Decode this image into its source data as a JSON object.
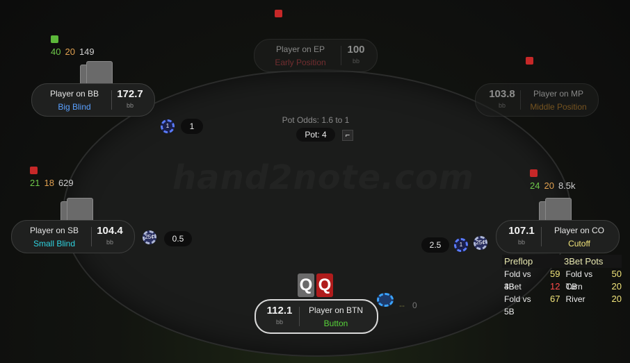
{
  "table": {
    "watermark": "hand2note.com",
    "pot_odds": "Pot Odds: 1.6 to 1",
    "pot": "Pot: 4",
    "pot_icon": "⌐"
  },
  "seats": {
    "ep": {
      "name": "Player on EP",
      "position": "Early Position",
      "stack": "100",
      "unit": "bb"
    },
    "bb": {
      "name": "Player on BB",
      "position": "Big Blind",
      "stack": "172.7",
      "unit": "bb",
      "bet": "1",
      "chip": "1",
      "hud": {
        "a": "40",
        "b": "20",
        "c": "149"
      }
    },
    "mp": {
      "name": "Player on MP",
      "position": "Middle Position",
      "stack": "103.8",
      "unit": "bb"
    },
    "sb": {
      "name": "Player on SB",
      "position": "Small Blind",
      "stack": "104.4",
      "unit": "bb",
      "bet": "0.5",
      "chip": "25¢",
      "hud": {
        "a": "21",
        "b": "18",
        "c": "629"
      }
    },
    "co": {
      "name": "Player on CO",
      "position": "Cutoff",
      "stack": "107.1",
      "unit": "bb",
      "bet": "2.5",
      "chip1": "1",
      "chip2": "25¢",
      "hud": {
        "a": "24",
        "b": "20",
        "c": "8.5k"
      }
    },
    "btn": {
      "name": "Player on BTN",
      "position": "Button",
      "stack": "112.1",
      "unit": "bb",
      "bet": "0",
      "bet_dashes": "--"
    }
  },
  "hero_cards": [
    "Q",
    "Q"
  ],
  "stats_panel": {
    "headers": [
      "Preflop",
      "3Bet Pots"
    ],
    "rows": [
      {
        "l1": "Fold vs 3B",
        "v1": "59",
        "l2": "Fold vs CB",
        "v2": "50"
      },
      {
        "l1": "4Bet",
        "v1": "12",
        "l2": "Turn",
        "v2": "20"
      },
      {
        "l1": "Fold vs 5B",
        "v1": "67",
        "l2": "River",
        "v2": "20"
      }
    ]
  },
  "colors": {
    "small_blind": "#2fd3e0",
    "big_blind": "#5aa0ff",
    "early_position": "#c0444a",
    "middle_position": "#c98a2e",
    "cutoff": "#f2e57a",
    "button": "#58d43a",
    "indicator_red": "#c62828",
    "indicator_green": "#5cb83a",
    "hero_card_gray": "#6b6b6b",
    "hero_card_red": "#b01c1c"
  }
}
